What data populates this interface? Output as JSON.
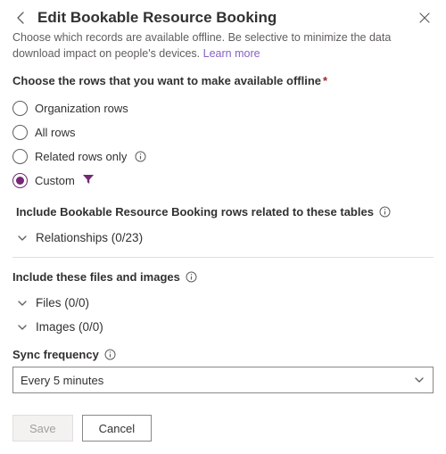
{
  "header": {
    "title": "Edit Bookable Resource Booking"
  },
  "subtitle": {
    "text": "Choose which records are available offline. Be selective to minimize the data download impact on people's devices. ",
    "link": "Learn more"
  },
  "rows_section": {
    "label": "Choose the rows that you want to make available offline",
    "options": {
      "org": "Organization rows",
      "all": "All rows",
      "related": "Related rows only",
      "custom": "Custom"
    }
  },
  "related_tables": {
    "label": "Include Bookable Resource Booking rows related to these tables",
    "relationships": "Relationships (0/23)"
  },
  "files_section": {
    "label": "Include these files and images",
    "files": "Files (0/0)",
    "images": "Images (0/0)"
  },
  "sync": {
    "label": "Sync frequency",
    "value": "Every 5 minutes"
  },
  "footer": {
    "save": "Save",
    "cancel": "Cancel"
  }
}
